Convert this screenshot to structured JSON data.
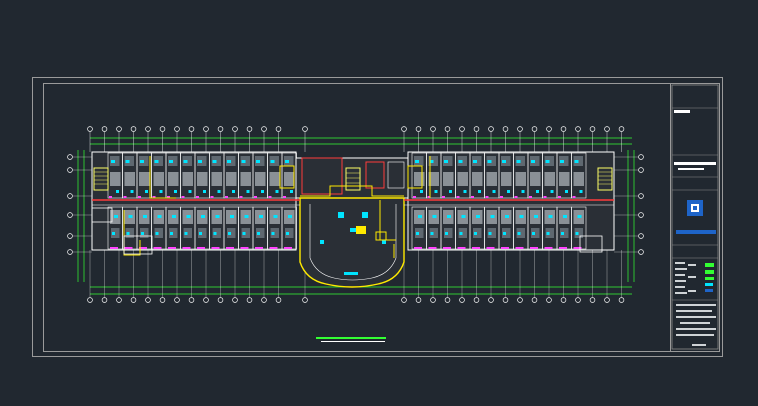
{
  "drawing": {
    "caption": "",
    "colors": {
      "background": "#212830",
      "frame": "#9a9a9a",
      "wall": "#ffffff",
      "corridor_line": "#ff3b3b",
      "route": "#ffea00",
      "fixture": "#00e5ff",
      "equipment": "#ff44ff",
      "accent_green": "#33ff33",
      "logo_blue": "#1e64c8",
      "stair": "#ffff66"
    },
    "title_block": {
      "logo_icon": "company-logo-icon"
    }
  }
}
